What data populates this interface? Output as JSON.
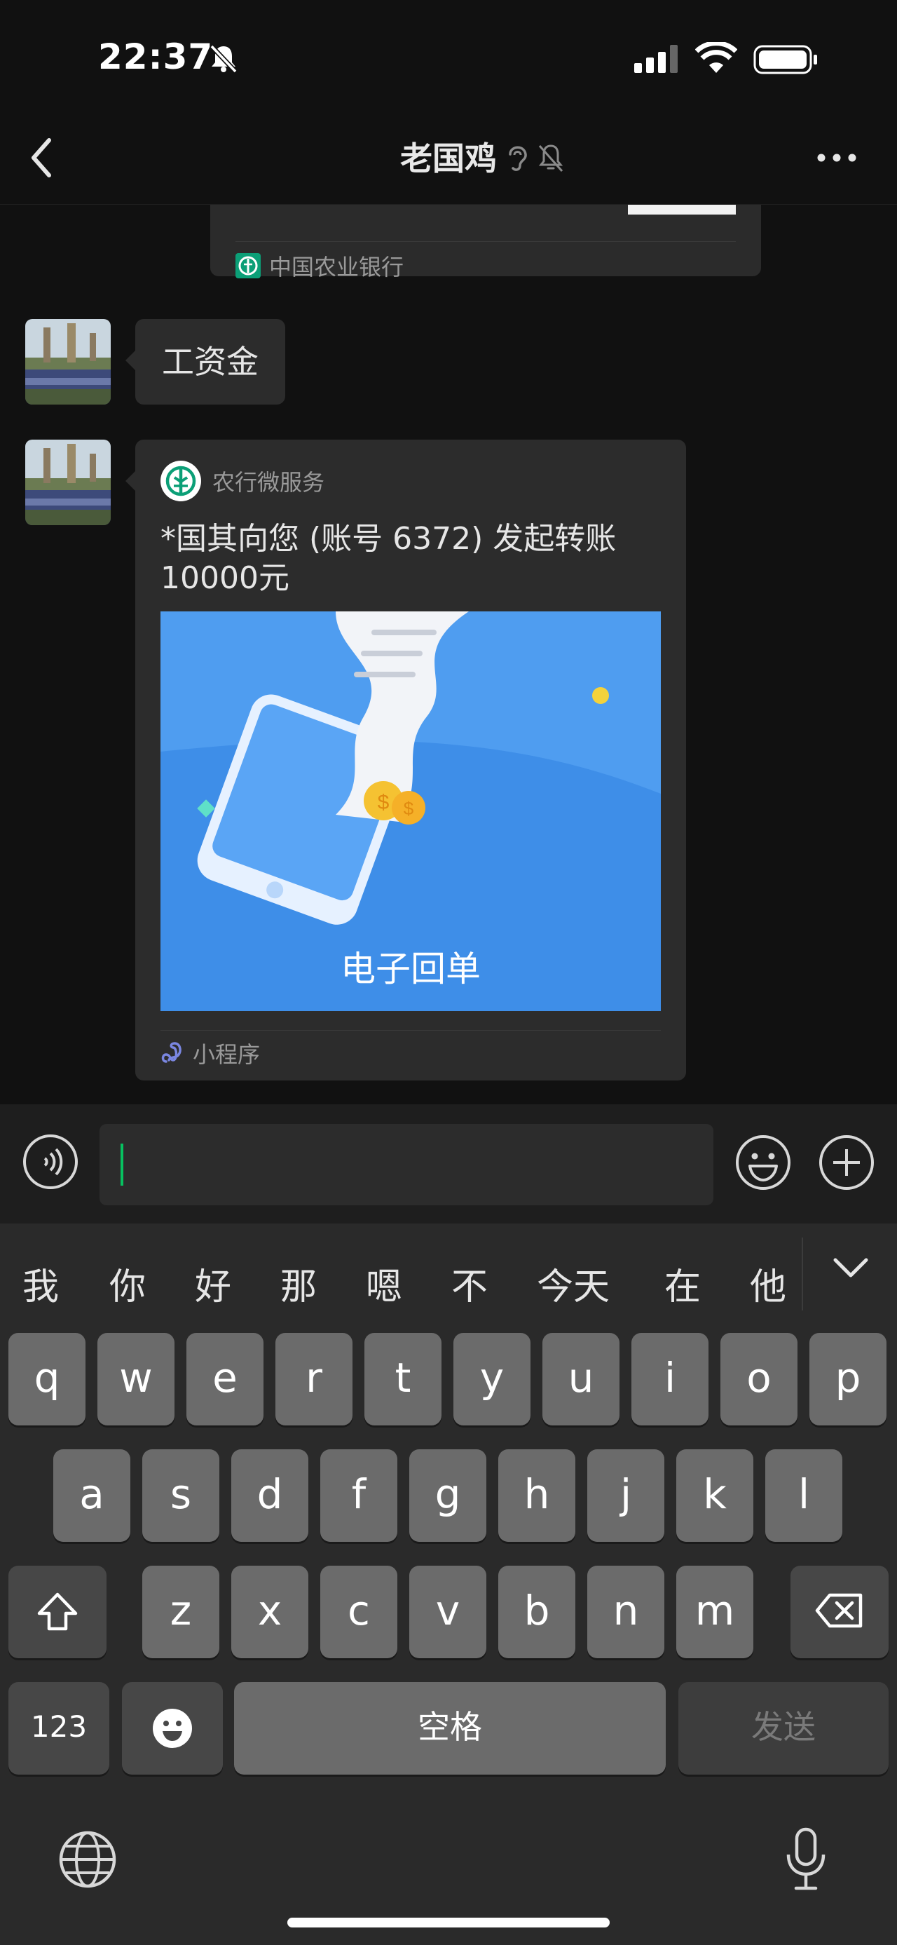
{
  "status_bar": {
    "time": "22:37"
  },
  "nav": {
    "title": "老国鸡"
  },
  "previous_card": {
    "source": "中国农业银行"
  },
  "messages": {
    "text_message": "工资金",
    "card": {
      "source": "农行微服务",
      "title": "*国其向您 (账号 6372) 发起转账 10000元",
      "image_caption": "电子回单",
      "footer": "小程序"
    }
  },
  "input": {
    "value": ""
  },
  "keyboard": {
    "candidates": [
      "我",
      "你",
      "好",
      "那",
      "嗯",
      "不",
      "今天",
      "在",
      "他"
    ],
    "row1": [
      "q",
      "w",
      "e",
      "r",
      "t",
      "y",
      "u",
      "i",
      "o",
      "p"
    ],
    "row2": [
      "a",
      "s",
      "d",
      "f",
      "g",
      "h",
      "j",
      "k",
      "l"
    ],
    "row3": [
      "z",
      "x",
      "c",
      "v",
      "b",
      "n",
      "m"
    ],
    "numbers_label": "123",
    "space_label": "空格",
    "send_label": "发送"
  },
  "colors": {
    "background": "#111111",
    "bubble": "#2c2c2c",
    "accent_green": "#07c160",
    "key": "#6b6b6b",
    "key_dark": "#474747"
  },
  "icons": [
    "bell-slash-icon",
    "signal-icon",
    "wifi-icon",
    "battery-icon",
    "back-chevron-icon",
    "ear-icon",
    "mute-icon",
    "more-icon",
    "abc-bank-logo-icon",
    "mini-program-icon",
    "voice-icon",
    "emoji-icon",
    "plus-icon",
    "chevron-down-icon",
    "shift-icon",
    "backspace-icon",
    "emoji-key-icon",
    "globe-icon",
    "mic-icon"
  ]
}
